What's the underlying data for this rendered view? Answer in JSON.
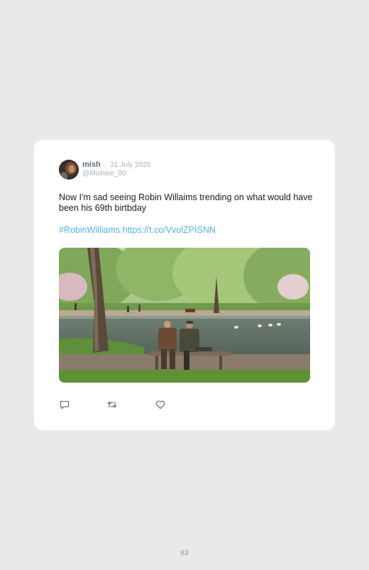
{
  "tweet": {
    "author_name": "mish",
    "separator": "·",
    "date": "21 July 2020",
    "handle": "@Mishiee_00",
    "text": "Now I'm sad seeing Robin Willaims trending on what would have been his 69th birtbday",
    "hashtag": "#RobinWilliams",
    "url": "https://t.co/VvolZPISNN",
    "image_alt": "Two men sitting on a park bench by a pond"
  },
  "actions": [
    {
      "name": "reply",
      "icon": "reply-icon"
    },
    {
      "name": "retweet",
      "icon": "retweet-icon"
    },
    {
      "name": "like",
      "icon": "heart-icon"
    }
  ],
  "colors": {
    "background": "#e9e9e9",
    "card": "#ffffff",
    "link": "#55b3e8",
    "muted": "#a7b0b8",
    "name": "#5b6b7b"
  },
  "page": {
    "number": "63"
  }
}
